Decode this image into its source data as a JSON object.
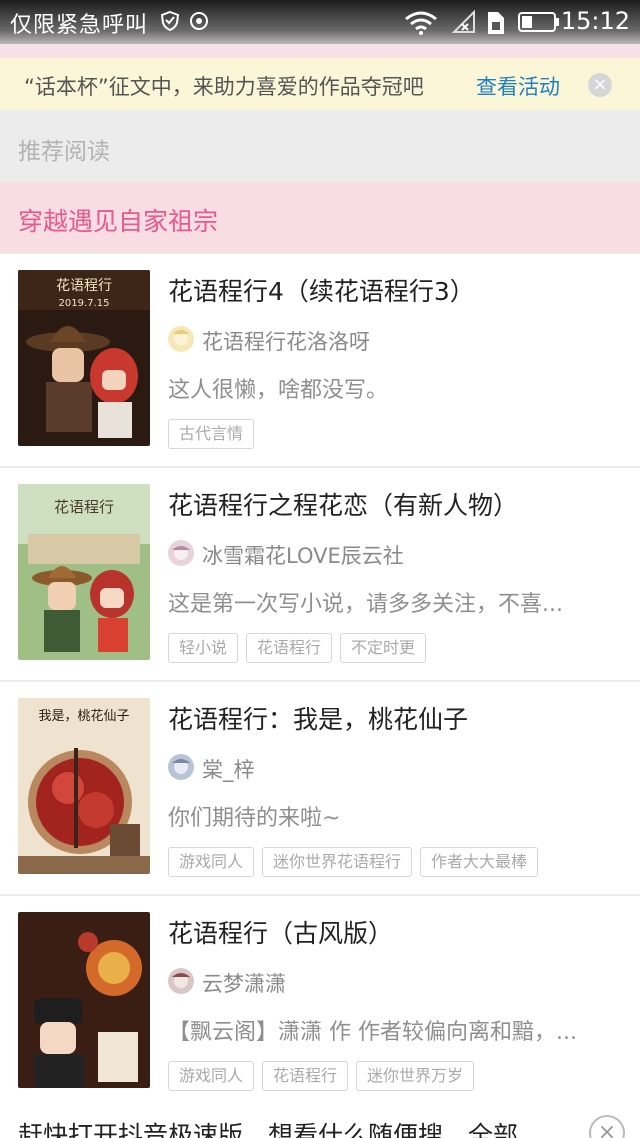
{
  "status_bar": {
    "carrier": "仅限紧急呼叫",
    "time": "15:12"
  },
  "banner": {
    "text": "“话本杯”征文中，来助力喜爱的作品夺冠吧",
    "link": "查看活动",
    "close_icon": "×"
  },
  "sections": {
    "recommend": "推荐阅读",
    "topic": "穿越遇见自家祖宗"
  },
  "books": [
    {
      "title": "花语程行4（续花语程行3）",
      "author": "花语程行花洛洛呀",
      "desc": "这人很懒，啥都没写。",
      "tags": [
        "古代言情"
      ],
      "cover_text": "2019.7.15",
      "colors": {
        "bg": "#2b1a12",
        "accent": "#c8382f"
      }
    },
    {
      "title": "花语程行之程花恋（有新人物）",
      "author": "冰雪霜花LOVE辰云社",
      "desc": "这是第一次写小说，请多多关注，不喜...",
      "tags": [
        "轻小说",
        "花语程行",
        "不定时更"
      ],
      "colors": {
        "bg": "#9fbf86",
        "accent": "#b8332c"
      }
    },
    {
      "title": "花语程行：我是，桃花仙子",
      "author": "棠_梓",
      "desc": "你们期待的来啦~",
      "tags": [
        "游戏同人",
        "迷你世界花语程行",
        "作者大大最棒"
      ],
      "cover_text": "我是，桃花仙子",
      "colors": {
        "bg": "#efe3cf",
        "accent": "#a3241f"
      }
    },
    {
      "title": "花语程行（古风版）",
      "author": "云梦潇潇",
      "desc": "【飘云阁】潇潇 作 作者较偏向离和黯，...",
      "tags": [
        "游戏同人",
        "花语程行",
        "迷你世界万岁"
      ],
      "colors": {
        "bg": "#3a1e14",
        "accent": "#d46a2a"
      }
    }
  ],
  "bottom_ad": {
    "text": "赶快打开抖音极速版，想看什么随便搜，全部",
    "close_icon": "×"
  }
}
